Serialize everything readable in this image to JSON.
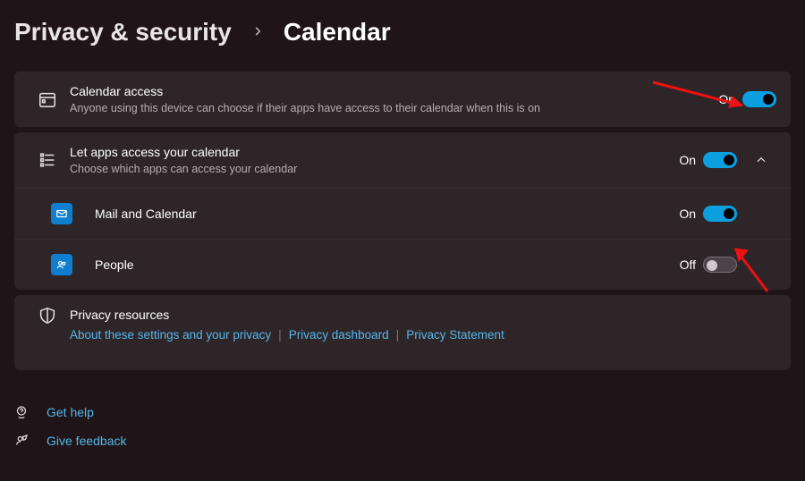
{
  "breadcrumb": {
    "parent": "Privacy & security",
    "current": "Calendar"
  },
  "calendar_access": {
    "title": "Calendar access",
    "subtitle": "Anyone using this device can choose if their apps have access to their calendar when this is on",
    "state": "On"
  },
  "let_apps": {
    "title": "Let apps access your calendar",
    "subtitle": "Choose which apps can access your calendar",
    "state": "On"
  },
  "apps": {
    "mail": {
      "label": "Mail and Calendar",
      "state": "On"
    },
    "people": {
      "label": "People",
      "state": "Off"
    }
  },
  "privacy": {
    "title": "Privacy resources",
    "link1": "About these settings and your privacy",
    "link2": "Privacy dashboard",
    "link3": "Privacy Statement"
  },
  "footer": {
    "help": "Get help",
    "feedback": "Give feedback"
  }
}
